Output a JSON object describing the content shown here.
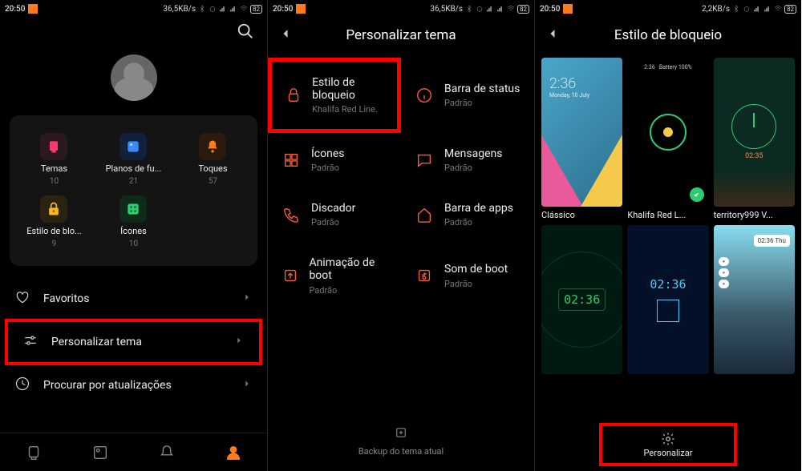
{
  "status": {
    "time": "20:50",
    "speed1": "36,5KB/s",
    "speed3": "2,2KB/s",
    "battery": "82"
  },
  "screen1": {
    "grid": [
      {
        "label": "Temas",
        "count": "10",
        "icon": "theme",
        "color": "#ff3a6a"
      },
      {
        "label": "Planos de fu...",
        "count": "21",
        "icon": "wallpaper",
        "color": "#3a8aff"
      },
      {
        "label": "Toques",
        "count": "57",
        "icon": "bell",
        "color": "#ff7a1a"
      },
      {
        "label": "Estilo de blo...",
        "count": "9",
        "icon": "lock",
        "color": "#ffb81a"
      },
      {
        "label": "Ícones",
        "count": "10",
        "icon": "icons",
        "color": "#2ecc71"
      }
    ],
    "menu": {
      "fav": "Favoritos",
      "personalize": "Personalizar tema",
      "updates": "Procurar por atualizações"
    }
  },
  "screen2": {
    "title": "Personalizar tema",
    "items": [
      {
        "title": "Estilo de bloqueio",
        "sub": "Khalifa Red Line.",
        "icon": "lock"
      },
      {
        "title": "Barra de status",
        "sub": "Padrão",
        "icon": "info"
      },
      {
        "title": "Ícones",
        "sub": "Padrão",
        "icon": "grid"
      },
      {
        "title": "Mensagens",
        "sub": "Padrão",
        "icon": "msg"
      },
      {
        "title": "Discador",
        "sub": "Padrão",
        "icon": "phone"
      },
      {
        "title": "Barra de apps",
        "sub": "Padrão",
        "icon": "home"
      },
      {
        "title": "Animação de boot",
        "sub": "Padrão",
        "icon": "boot"
      },
      {
        "title": "Som de boot",
        "sub": "Padrão",
        "icon": "sound"
      }
    ],
    "backup": "Backup do tema atual"
  },
  "screen3": {
    "title": "Estilo de bloqueio",
    "thumbs": [
      {
        "cap": "Clássico",
        "time": "2:36",
        "date": "Monday, 10 July"
      },
      {
        "cap": "Khalifa Red L...",
        "selected": true
      },
      {
        "cap": "territory999 V...",
        "digital": "02:35"
      },
      {
        "cap": "",
        "digital": "02:36"
      },
      {
        "cap": "",
        "digital": "02:36"
      },
      {
        "cap": "",
        "digital": "02:36"
      }
    ],
    "button": "Personalizar"
  }
}
